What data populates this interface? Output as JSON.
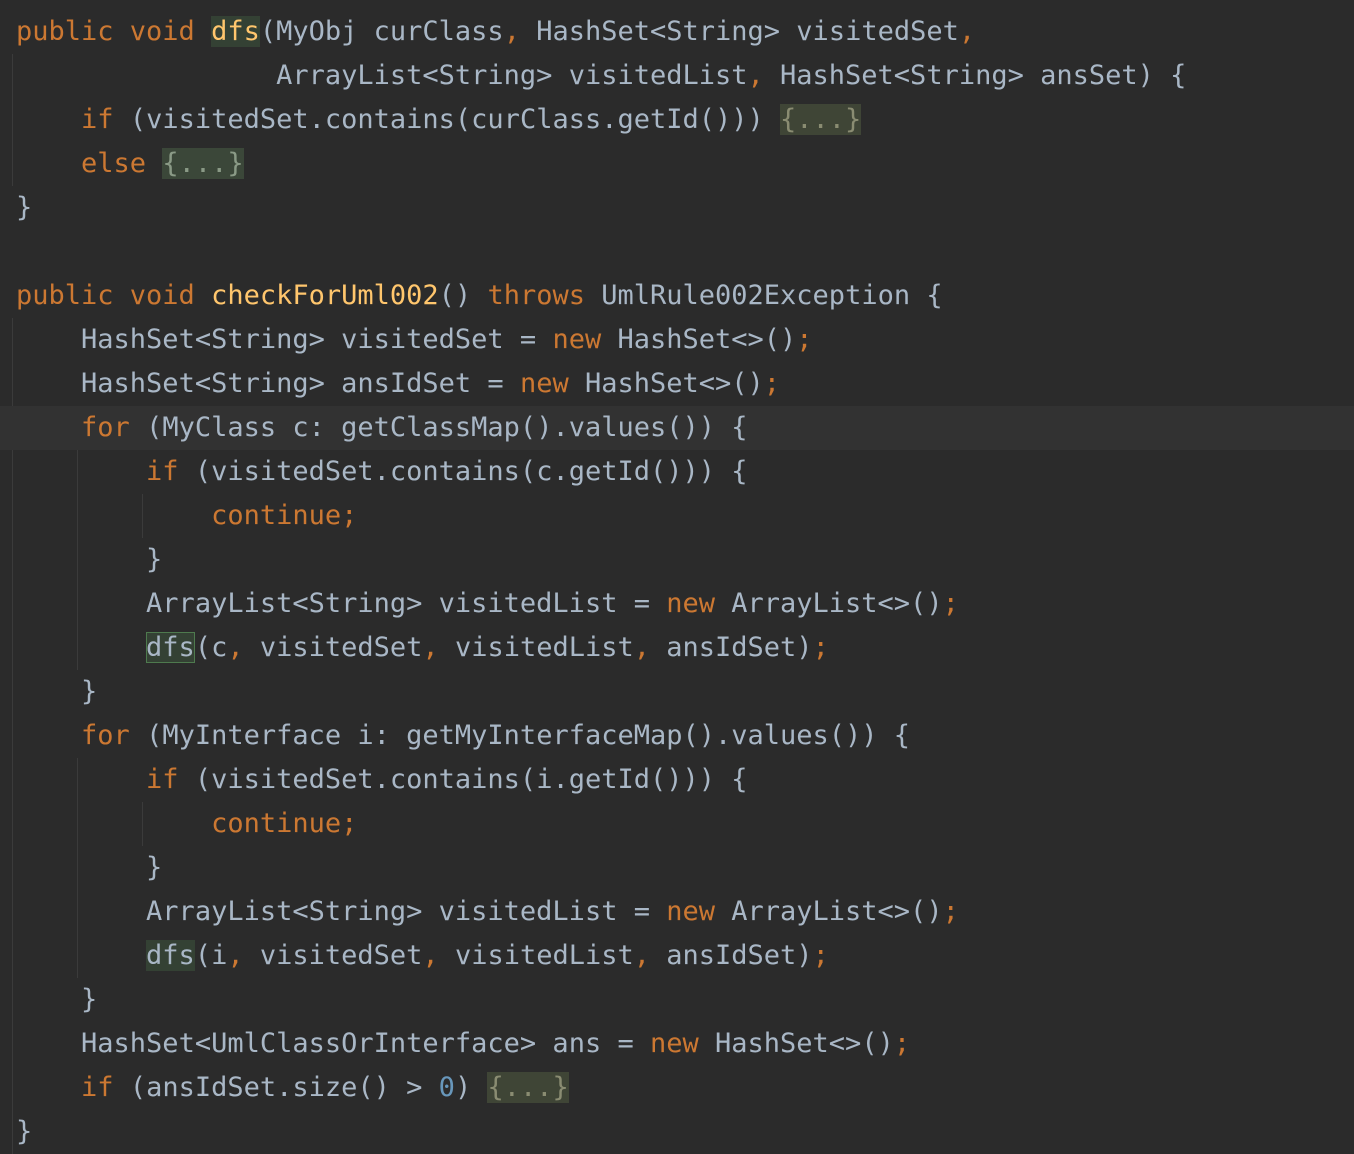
{
  "editor": {
    "theme": {
      "background": "#2b2b2b",
      "current_line": "#323232",
      "keyword": "#cc7832",
      "function": "#ffc66d",
      "text": "#a9b7c6",
      "number": "#6897bb",
      "usage_highlight": "#344134"
    },
    "current_line_index": 9,
    "lines": [
      {
        "indent": "",
        "tokens": [
          {
            "t": "public void ",
            "c": "kw"
          },
          {
            "t": "dfs",
            "c": "fn hl-plain"
          },
          {
            "t": "(MyObj curClass",
            "c": ""
          },
          {
            "t": ", ",
            "c": "kw"
          },
          {
            "t": "HashSet<String> visitedSet",
            "c": ""
          },
          {
            "t": ",",
            "c": "kw"
          }
        ]
      },
      {
        "indent": "                ",
        "tokens": [
          {
            "t": "ArrayList<String> visitedList",
            "c": ""
          },
          {
            "t": ", ",
            "c": "kw"
          },
          {
            "t": "HashSet<String> ansSet) {",
            "c": ""
          }
        ]
      },
      {
        "indent": "    ",
        "tokens": [
          {
            "t": "if ",
            "c": "kw"
          },
          {
            "t": "(visitedSet.contains(curClass.getId())) ",
            "c": ""
          },
          {
            "t": "{...}",
            "c": "fold-dark"
          }
        ]
      },
      {
        "indent": "    ",
        "tokens": [
          {
            "t": "else ",
            "c": "kw"
          },
          {
            "t": "{...}",
            "c": "fold"
          }
        ]
      },
      {
        "indent": "",
        "tokens": [
          {
            "t": "}",
            "c": ""
          }
        ]
      },
      {
        "indent": "",
        "tokens": []
      },
      {
        "indent": "",
        "tokens": [
          {
            "t": "public void ",
            "c": "kw"
          },
          {
            "t": "checkForUml002",
            "c": "fn"
          },
          {
            "t": "() ",
            "c": ""
          },
          {
            "t": "throws ",
            "c": "kw"
          },
          {
            "t": "UmlRule002Exception {",
            "c": ""
          }
        ]
      },
      {
        "indent": "    ",
        "tokens": [
          {
            "t": "HashSet<String> visitedSet = ",
            "c": ""
          },
          {
            "t": "new ",
            "c": "kw"
          },
          {
            "t": "HashSet<>()",
            "c": ""
          },
          {
            "t": ";",
            "c": "kw"
          }
        ]
      },
      {
        "indent": "    ",
        "tokens": [
          {
            "t": "HashSet<String> ansIdSet = ",
            "c": ""
          },
          {
            "t": "new ",
            "c": "kw"
          },
          {
            "t": "HashSet<>()",
            "c": ""
          },
          {
            "t": ";",
            "c": "kw"
          }
        ]
      },
      {
        "indent": "    ",
        "tokens": [
          {
            "t": "for ",
            "c": "kw"
          },
          {
            "t": "(MyClass c: getClassMap().values()) {",
            "c": ""
          }
        ]
      },
      {
        "indent": "        ",
        "tokens": [
          {
            "t": "if ",
            "c": "kw"
          },
          {
            "t": "(visitedSet.contains(c.getId())) {",
            "c": ""
          }
        ]
      },
      {
        "indent": "            ",
        "tokens": [
          {
            "t": "continue;",
            "c": "kw"
          }
        ]
      },
      {
        "indent": "        ",
        "tokens": [
          {
            "t": "}",
            "c": ""
          }
        ]
      },
      {
        "indent": "        ",
        "tokens": [
          {
            "t": "ArrayList<String> visitedList = ",
            "c": ""
          },
          {
            "t": "new ",
            "c": "kw"
          },
          {
            "t": "ArrayList<>()",
            "c": ""
          },
          {
            "t": ";",
            "c": "kw"
          }
        ]
      },
      {
        "indent": "        ",
        "tokens": [
          {
            "t": "dfs",
            "c": "hl"
          },
          {
            "t": "(c",
            "c": ""
          },
          {
            "t": ", ",
            "c": "kw"
          },
          {
            "t": "visitedSet",
            "c": ""
          },
          {
            "t": ", ",
            "c": "kw"
          },
          {
            "t": "visitedList",
            "c": ""
          },
          {
            "t": ", ",
            "c": "kw"
          },
          {
            "t": "ansIdSet)",
            "c": ""
          },
          {
            "t": ";",
            "c": "kw"
          }
        ]
      },
      {
        "indent": "    ",
        "tokens": [
          {
            "t": "}",
            "c": ""
          }
        ]
      },
      {
        "indent": "    ",
        "tokens": [
          {
            "t": "for ",
            "c": "kw"
          },
          {
            "t": "(MyInterface i: getMyInterfaceMap().values()) {",
            "c": ""
          }
        ]
      },
      {
        "indent": "        ",
        "tokens": [
          {
            "t": "if ",
            "c": "kw"
          },
          {
            "t": "(visitedSet.contains(i.getId())) {",
            "c": ""
          }
        ]
      },
      {
        "indent": "            ",
        "tokens": [
          {
            "t": "continue;",
            "c": "kw"
          }
        ]
      },
      {
        "indent": "        ",
        "tokens": [
          {
            "t": "}",
            "c": ""
          }
        ]
      },
      {
        "indent": "        ",
        "tokens": [
          {
            "t": "ArrayList<String> visitedList = ",
            "c": ""
          },
          {
            "t": "new ",
            "c": "kw"
          },
          {
            "t": "ArrayList<>()",
            "c": ""
          },
          {
            "t": ";",
            "c": "kw"
          }
        ]
      },
      {
        "indent": "        ",
        "tokens": [
          {
            "t": "dfs",
            "c": "hl-plain"
          },
          {
            "t": "(i",
            "c": ""
          },
          {
            "t": ", ",
            "c": "kw"
          },
          {
            "t": "visitedSet",
            "c": ""
          },
          {
            "t": ", ",
            "c": "kw"
          },
          {
            "t": "visitedList",
            "c": ""
          },
          {
            "t": ", ",
            "c": "kw"
          },
          {
            "t": "ansIdSet)",
            "c": ""
          },
          {
            "t": ";",
            "c": "kw"
          }
        ]
      },
      {
        "indent": "    ",
        "tokens": [
          {
            "t": "}",
            "c": ""
          }
        ]
      },
      {
        "indent": "    ",
        "tokens": [
          {
            "t": "HashSet<UmlClassOrInterface> ans = ",
            "c": ""
          },
          {
            "t": "new ",
            "c": "kw"
          },
          {
            "t": "HashSet<>()",
            "c": ""
          },
          {
            "t": ";",
            "c": "kw"
          }
        ]
      },
      {
        "indent": "    ",
        "tokens": [
          {
            "t": "if ",
            "c": "kw"
          },
          {
            "t": "(ansIdSet.size() > ",
            "c": ""
          },
          {
            "t": "0",
            "c": "num"
          },
          {
            "t": ") ",
            "c": ""
          },
          {
            "t": "{...}",
            "c": "fold-dark"
          }
        ]
      },
      {
        "indent": "",
        "tokens": [
          {
            "t": "}",
            "c": ""
          }
        ]
      }
    ]
  }
}
